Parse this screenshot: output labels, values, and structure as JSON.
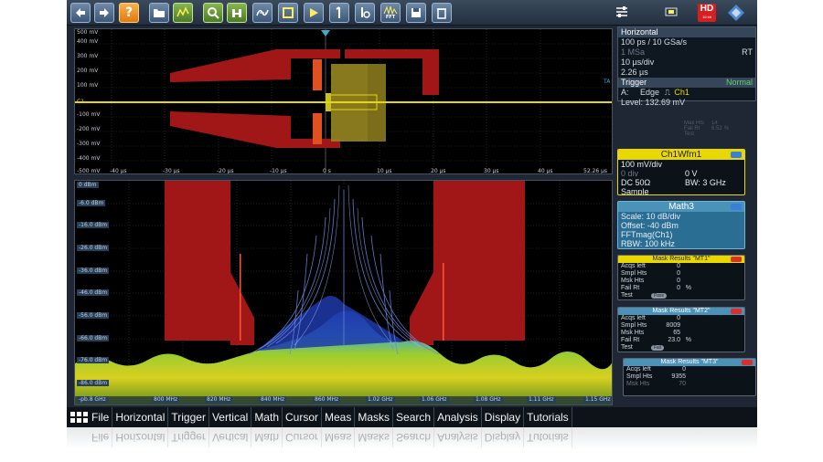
{
  "toolbar": {
    "buttons": [
      {
        "icon": "undo-icon"
      },
      {
        "icon": "redo-icon"
      },
      {
        "icon": "help-icon",
        "label": "?"
      },
      {
        "icon": "open-folder-icon"
      },
      {
        "icon": "autoset-icon"
      },
      {
        "icon": "zoom-icon"
      },
      {
        "icon": "histogram-icon"
      },
      {
        "icon": "measure-icon"
      },
      {
        "icon": "mask-icon"
      },
      {
        "icon": "cursor-icon"
      },
      {
        "icon": "math-icon"
      },
      {
        "icon": "reference-icon"
      },
      {
        "icon": "fft-icon",
        "label": "FFT"
      },
      {
        "icon": "save-icon"
      },
      {
        "icon": "delete-icon"
      }
    ],
    "right_icons": [
      "signal-bar-icon",
      "hd-badge-icon",
      "rohde-schwarz-logo-icon"
    ],
    "hd_label": "HD",
    "hd_sub": "16 bit"
  },
  "plot_top": {
    "y_labels": [
      "500 mV",
      "400 mV",
      "300 mV",
      "200 mV",
      "100 mV",
      "C1",
      "-100 mV",
      "-200 mV",
      "-300 mV",
      "-400 mV",
      "-500 mV"
    ],
    "x_labels": [
      "-40 µs",
      "-30 µs",
      "-20 µs",
      "-10 µs",
      "0 s",
      "10 µs",
      "20 µs",
      "30 µs",
      "40 µs",
      "52.26 µs"
    ],
    "trigger_marker": "TA"
  },
  "plot_bot": {
    "y_labels": [
      "0 dBm",
      "-6.0 dBm",
      "-16.0 dBm",
      "-26.0 dBm",
      "-36.0 dBm",
      "-46.0 dBm",
      "-56.0 dBm",
      "-66.0 dBm",
      "-76.0 dBm",
      "-86.0 dBm"
    ],
    "x_labels": [
      "-pb.8 GHz",
      "800 MHz",
      "820 MHz",
      "840 MHz",
      "860 MHz",
      "1.02 GHz",
      "1.06 GHz",
      "1.08 GHz",
      "1.11 GHz",
      "1.15 GHz"
    ]
  },
  "horizontal": {
    "title": "Horizontal",
    "line1": "100 ps / 10 GSa/s",
    "line2": "1 MSa",
    "rt": "RT",
    "line3": "10 µs/div",
    "line4": "2.26 µs"
  },
  "trigger": {
    "title": "Trigger",
    "mode": "Normal",
    "line1_a": "A:",
    "line1_b": "Edge",
    "line1_c": "Ch1",
    "line2": "Level: 132.69 mV"
  },
  "ghost_mask": {
    "rows": [
      [
        "Max Hts",
        "14"
      ],
      [
        "Fail Rt",
        "6.52",
        "%"
      ],
      [
        "Test",
        ""
      ]
    ]
  },
  "ch1": {
    "title": "Ch1Wfm1",
    "scale": "100 mV/div",
    "offset_l": "0 div",
    "offset_r": "0 V",
    "coupling": "DC 50Ω",
    "bw": "BW: 3 GHz",
    "mode": "Sample"
  },
  "math3": {
    "title": "Math3",
    "scale": "Scale: 10 dB/div",
    "offset": "Offset: -40 dBm",
    "func": "FFTmag(Ch1)",
    "rbw": "RBW: 100 kHz"
  },
  "mt1": {
    "title": "Mask Results \"MT1\"",
    "rows": [
      [
        "Acqs left",
        "0",
        ""
      ],
      [
        "Smpl Hts",
        "0",
        ""
      ],
      [
        "Msk Hts",
        "0",
        ""
      ],
      [
        "Fail Rt",
        "0",
        "%"
      ]
    ],
    "test_label": "Test",
    "test_value": "Pass"
  },
  "mt2": {
    "title": "Mask Results \"MT2\"",
    "rows": [
      [
        "Acqs left",
        "0",
        ""
      ],
      [
        "Smpl Hts",
        "8009",
        ""
      ],
      [
        "Msk Hts",
        "65",
        ""
      ],
      [
        "Fail Rt",
        "23.0",
        "%"
      ]
    ],
    "test_label": "Test",
    "test_value": "Fail"
  },
  "mt3": {
    "title": "Mask Results \"MT3\"",
    "rows": [
      [
        "Acqs left",
        "0",
        ""
      ],
      [
        "Smpl Hts",
        "9355",
        ""
      ],
      [
        "Msk Hts",
        "70",
        ""
      ]
    ]
  },
  "menu": [
    "File",
    "Horizontal",
    "Trigger",
    "Vertical",
    "Math",
    "Cursor",
    "Meas",
    "Masks",
    "Search",
    "Analysis",
    "Display",
    "Tutorials"
  ],
  "colors": {
    "ch1": "#e8d800",
    "math": "#2a7fa8",
    "mask_red": "#a01818",
    "mask_fail": "#ff3333"
  }
}
